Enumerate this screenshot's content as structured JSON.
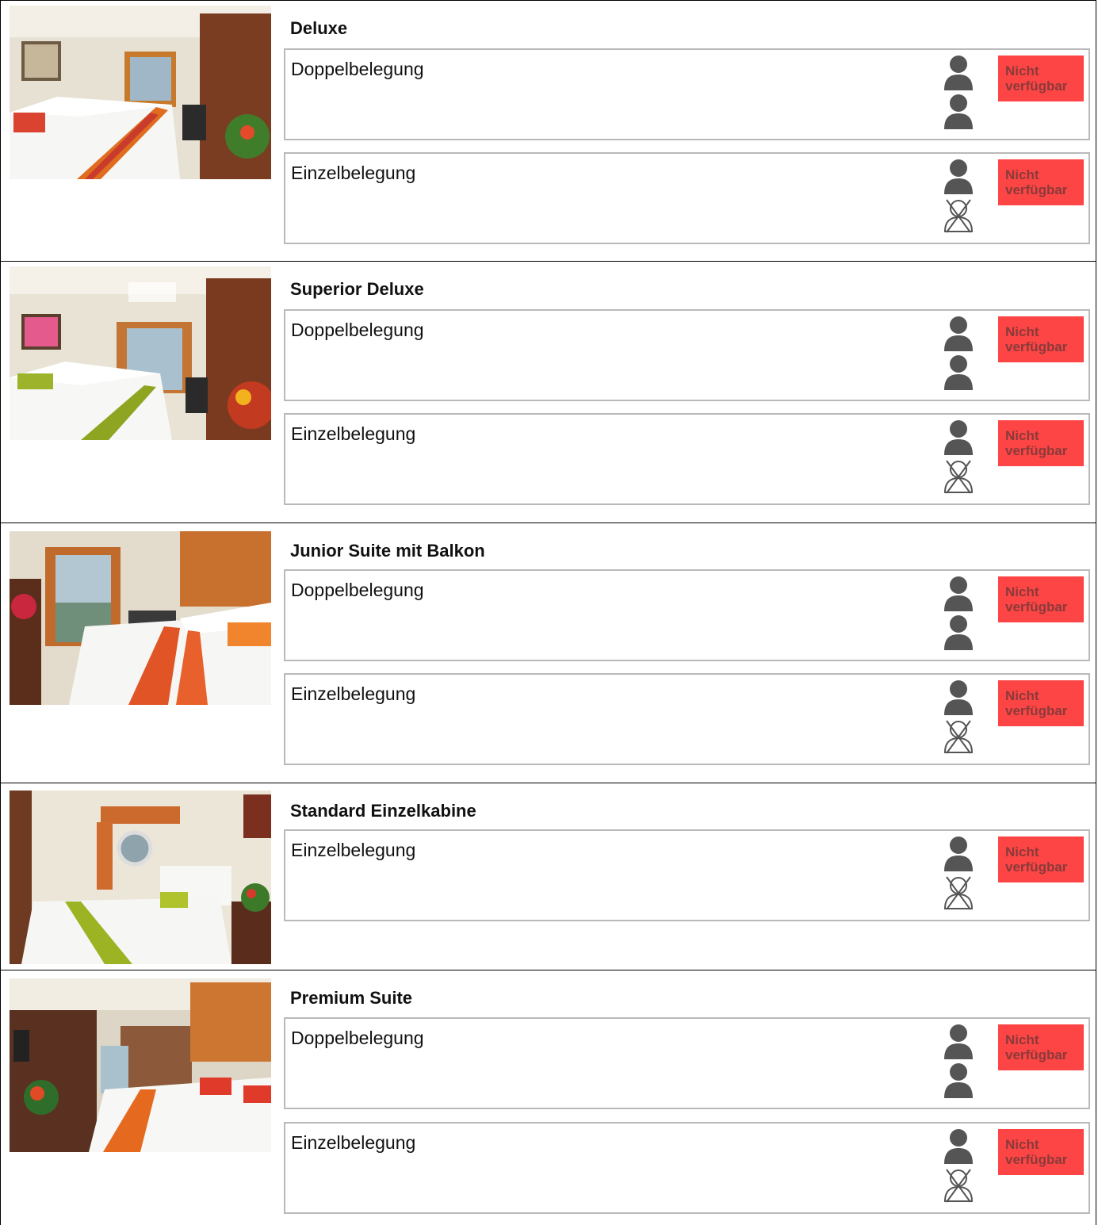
{
  "colors": {
    "unavailable_badge": "#fe4545",
    "person_icon": "#555555",
    "border": "#b9b9b9"
  },
  "cabins": [
    {
      "name": "Deluxe",
      "photo_alt": "Deluxe",
      "occupancies": [
        {
          "label": "Doppelbelegung",
          "persons": [
            "person-icon",
            "person-icon"
          ],
          "status": "Nicht verfügbar"
        },
        {
          "label": "Einzelbelegung",
          "persons": [
            "person-icon",
            "person-crossed-icon"
          ],
          "status": "Nicht verfügbar"
        }
      ]
    },
    {
      "name": "Superior Deluxe",
      "photo_alt": "Superior Deluxe",
      "occupancies": [
        {
          "label": "Doppelbelegung",
          "persons": [
            "person-icon",
            "person-icon"
          ],
          "status": "Nicht verfügbar"
        },
        {
          "label": "Einzelbelegung",
          "persons": [
            "person-icon",
            "person-crossed-icon"
          ],
          "status": "Nicht verfügbar"
        }
      ]
    },
    {
      "name": "Junior Suite mit Balkon",
      "photo_alt": "Junior Suite mit Balkon",
      "occupancies": [
        {
          "label": "Doppelbelegung",
          "persons": [
            "person-icon",
            "person-icon"
          ],
          "status": "Nicht verfügbar"
        },
        {
          "label": "Einzelbelegung",
          "persons": [
            "person-icon",
            "person-crossed-icon"
          ],
          "status": "Nicht verfügbar"
        }
      ]
    },
    {
      "name": "Standard Einzelkabine",
      "photo_alt": "Standard Einzelkabine",
      "occupancies": [
        {
          "label": "Einzelbelegung",
          "persons": [
            "person-icon",
            "person-crossed-icon"
          ],
          "status": "Nicht verfügbar"
        }
      ]
    },
    {
      "name": "Premium Suite",
      "photo_alt": "Premium Suite",
      "occupancies": [
        {
          "label": "Doppelbelegung",
          "persons": [
            "person-icon",
            "person-icon"
          ],
          "status": "Nicht verfügbar"
        },
        {
          "label": "Einzelbelegung",
          "persons": [
            "person-icon",
            "person-crossed-icon"
          ],
          "status": "Nicht verfügbar"
        }
      ]
    }
  ]
}
